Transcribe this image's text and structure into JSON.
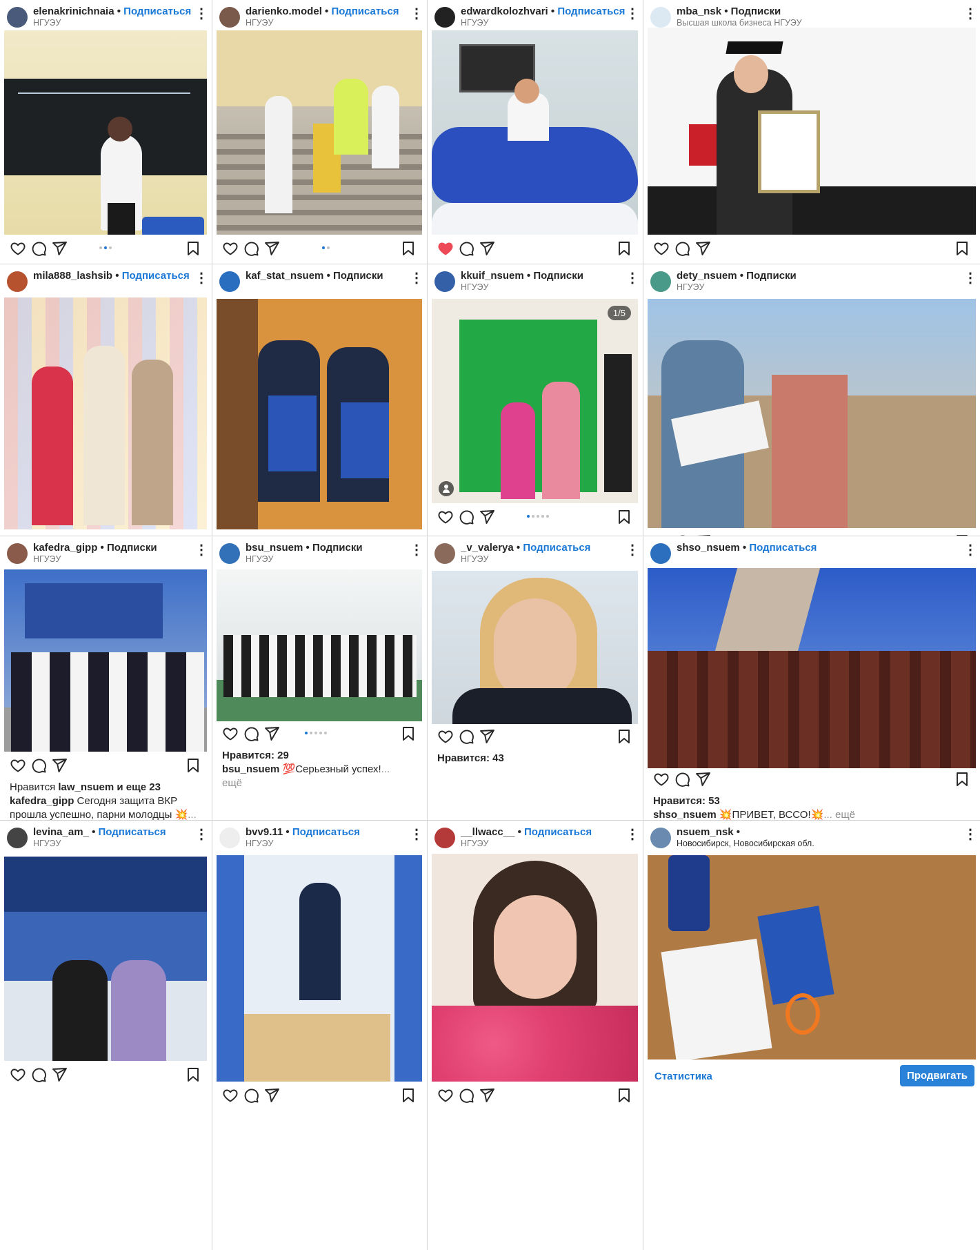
{
  "posts": [
    {
      "user": "elenakrinichnaia",
      "action": "Подписаться",
      "action_style": "blue",
      "location": "НГУЭУ"
    },
    {
      "user": "darienko.model",
      "action": "Подписаться",
      "action_style": "blue",
      "location": "НГУЭУ"
    },
    {
      "user": "edwardkolozhvari",
      "action": "Подписаться",
      "action_style": "blue",
      "location": "НГУЭУ"
    },
    {
      "user": "mba_nsk",
      "action": "Подписки",
      "action_style": "black",
      "location": "Высшая школа бизнеса НГУЭУ"
    },
    {
      "user": "mila888_lashsib",
      "action": "Подписаться",
      "action_style": "blue",
      "location": ""
    },
    {
      "user": "kaf_stat_nsuem",
      "action": "Подписки",
      "action_style": "black",
      "location": ""
    },
    {
      "user": "kkuif_nsuem",
      "action": "Подписки",
      "action_style": "black",
      "location": "НГУЭУ",
      "badge": "1/5"
    },
    {
      "user": "dety_nsuem",
      "action": "Подписки",
      "action_style": "black",
      "location": "НГУЭУ"
    },
    {
      "user": "kafedra_gipp",
      "action": "Подписки",
      "action_style": "black",
      "location": "НГУЭУ",
      "likes_prefix": "Нравится ",
      "likes_user": "law_nsuem",
      "likes_suffix": " и еще 23",
      "caption_user": "kafedra_gipp",
      "caption_text": " Сегодня защита ВКР прошла успешно, парни молодцы 💥",
      "caption_more": "... ещё"
    },
    {
      "user": "bsu_nsuem",
      "action": "Подписки",
      "action_style": "black",
      "location": "НГУЭУ",
      "likes": "Нравится: 29",
      "caption_user": "bsu_nsuem",
      "caption_text": " 💯Серьезный успех!",
      "caption_more": "... ещё"
    },
    {
      "user": "_v_valerya",
      "action": "Подписаться",
      "action_style": "blue",
      "location": "НГУЭУ",
      "likes": "Нравится: 43"
    },
    {
      "user": "shso_nsuem",
      "action": "Подписаться",
      "action_style": "blue",
      "location": "",
      "likes": "Нравится: 53",
      "caption_user": "shso_nsuem",
      "caption_text": " 💥ПРИВЕТ, ВССО!💥",
      "caption_more": "... ещё"
    },
    {
      "user": "levina_am_",
      "action": "Подписаться",
      "action_style": "blue",
      "location": "НГУЭУ"
    },
    {
      "user": "bvv9.11",
      "action": "Подписаться",
      "action_style": "blue",
      "location": "НГУЭУ"
    },
    {
      "user": "__llwacc__",
      "action": "Подписаться",
      "action_style": "blue",
      "location": "НГУЭУ"
    },
    {
      "user": "nsuem_nsk",
      "action": "",
      "action_style": "black",
      "location": "Новосибирск, Новосибирская обл.",
      "location_dark": true,
      "stats": "Статистика",
      "promote": "Продвигать"
    }
  ],
  "separator": "•",
  "icons": [
    "heart-icon",
    "comment-icon",
    "share-icon",
    "bookmark-icon",
    "more-icon"
  ],
  "colors": {
    "link_blue": "#1a78d6",
    "liked_red": "#ed4956",
    "promote_blue": "#2a82d8"
  }
}
